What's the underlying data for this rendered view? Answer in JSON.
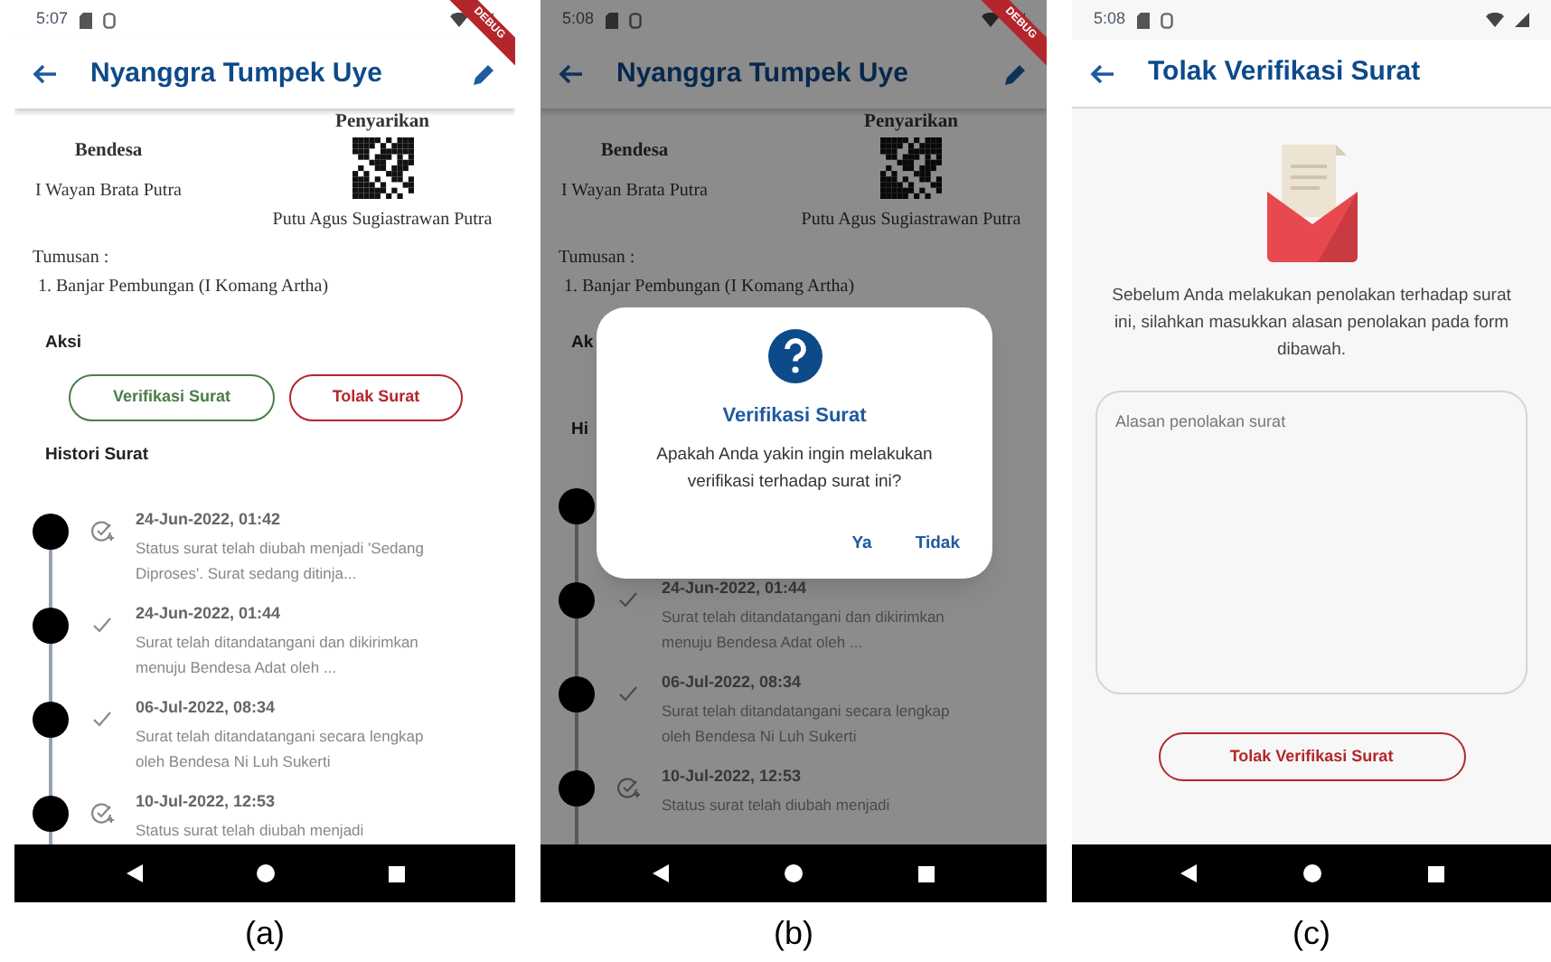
{
  "screens": [
    {
      "kind": "detail",
      "caption": "(a)",
      "status_bar": {
        "time": "5:07"
      },
      "debug_banner": "DEBUG",
      "app_bar": {
        "title": "Nyanggra Tumpek Uye"
      },
      "letter": {
        "right_title": "Penyarikan",
        "left_title": "Bendesa",
        "left_name": "I Wayan Brata Putra",
        "right_name": "Putu Agus Sugiastrawan Putra",
        "tumusan_label": "Tumusan :",
        "tumusan_items": [
          "1. Banjar Pembungan (I Komang Artha)"
        ]
      },
      "aksi_label": "Aksi",
      "actions": [
        {
          "label": "Verifikasi Surat",
          "kind": "verify"
        },
        {
          "label": "Tolak Surat",
          "kind": "reject"
        }
      ],
      "history_label": "Histori Surat",
      "history": [
        {
          "kind": "status",
          "date": "24-Jun-2022, 01:42",
          "description": "Status surat telah diubah menjadi 'Sedang Diproses'. Surat sedang ditinja..."
        },
        {
          "kind": "check",
          "date": "24-Jun-2022, 01:44",
          "description": "Surat telah ditandatangani dan dikirimkan menuju Bendesa Adat oleh ..."
        },
        {
          "kind": "check",
          "date": "06-Jul-2022, 08:34",
          "description": "Surat telah ditandatangani secara lengkap oleh Bendesa Ni Luh Sukerti"
        },
        {
          "kind": "status",
          "date": "10-Jul-2022, 12:53",
          "description": "Status surat telah diubah menjadi"
        }
      ]
    },
    {
      "kind": "detail",
      "caption": "(b)",
      "status_bar": {
        "time": "5:08"
      },
      "debug_banner": "DEBUG",
      "app_bar": {
        "title": "Nyanggra Tumpek Uye"
      },
      "letter": {
        "right_title": "Penyarikan",
        "left_title": "Bendesa",
        "left_name": "I Wayan Brata Putra",
        "right_name": "Putu Agus Sugiastrawan Putra",
        "tumusan_label": "Tumusan :",
        "tumusan_items": [
          "1. Banjar Pembungan (I Komang Artha)"
        ]
      },
      "aksi_label": "Ak",
      "history_label": "Hi",
      "history": [
        {
          "kind": "dot"
        },
        {
          "kind": "check",
          "date": "24-Jun-2022, 01:44",
          "description": "Surat telah ditandatangani dan dikirimkan menuju Bendesa Adat oleh ..."
        },
        {
          "kind": "check",
          "date": "06-Jul-2022, 08:34",
          "description": "Surat telah ditandatangani secara lengkap oleh Bendesa Ni Luh Sukerti"
        },
        {
          "kind": "status",
          "date": "10-Jul-2022, 12:53",
          "description": "Status surat telah diubah menjadi"
        }
      ],
      "dialog": {
        "title": "Verifikasi Surat",
        "message": "Apakah Anda yakin ingin melakukan verifikasi terhadap surat ini?",
        "buttons": [
          "Ya",
          "Tidak"
        ]
      }
    },
    {
      "kind": "form",
      "caption": "(c)",
      "status_bar": {
        "time": "5:08"
      },
      "app_bar": {
        "title": "Tolak Verifikasi Surat"
      },
      "instructions": "Sebelum Anda melakukan penolakan terhadap surat ini, silahkan masukkan alasan penolakan pada form dibawah.",
      "reason_field": {
        "placeholder": "Alasan penolakan surat"
      },
      "submit_button": "Tolak Verifikasi Surat"
    }
  ]
}
